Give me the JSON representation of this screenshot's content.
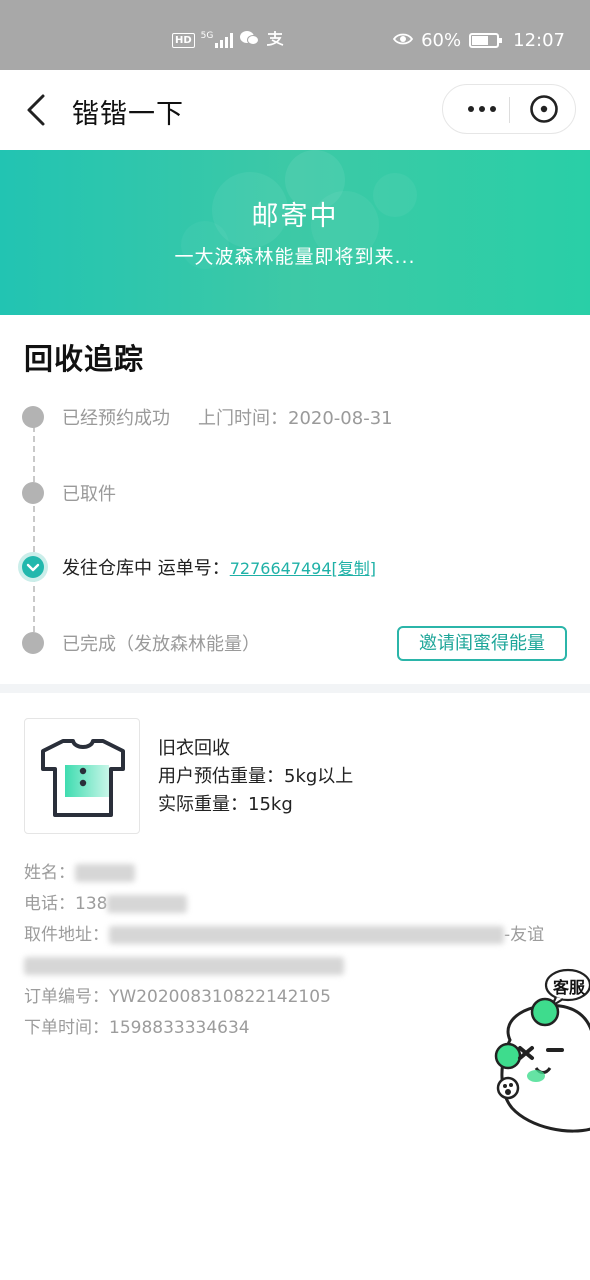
{
  "status_bar": {
    "hd": "HD",
    "network": "5G",
    "battery_percent": "60%",
    "battery_level": 0.6,
    "time": "12:07"
  },
  "nav": {
    "title": "锴锴一下"
  },
  "banner": {
    "title": "邮寄中",
    "subtitle": "一大波森林能量即将到来..."
  },
  "tracking": {
    "title": "回收追踪",
    "steps": [
      {
        "label": "已经预约成功",
        "extra": "上门时间：2020-08-31"
      },
      {
        "label": "已取件"
      },
      {
        "label": "发往仓库中 运单号：",
        "waybill": "7276647494[复制]"
      },
      {
        "label": "已完成（发放森林能量）"
      }
    ],
    "invite_button": "邀请闺蜜得能量"
  },
  "product": {
    "name": "旧衣回收",
    "estimated_weight": "用户预估重量：5kg以上",
    "actual_weight": "实际重量：15kg"
  },
  "details": {
    "name_label": "姓名：",
    "phone_label": "电话：",
    "phone_prefix": "138",
    "address_label": "取件地址：",
    "address_tail": "-友谊",
    "order_label": "订单编号：",
    "order_no": "YW20200831082214210​5",
    "time_label": "下单时间：",
    "time_value": "1598833334634"
  },
  "customer_service": {
    "label": "客服"
  },
  "colors": {
    "accent": "#22b8ad",
    "banner_start": "#22c4b2",
    "banner_end": "#29cfa7",
    "status_bar": "#a8a8a8"
  }
}
